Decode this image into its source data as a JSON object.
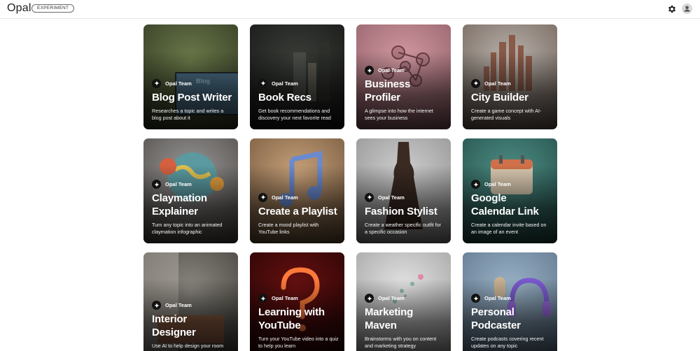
{
  "header": {
    "logo": "Opal",
    "badge": "EXPERIMENT"
  },
  "icons": {
    "settings": "gear-icon",
    "account": "account-icon",
    "author": "sparkle-icon"
  },
  "cards": [
    {
      "author": "Opal Team",
      "title": "Blog Post Writer",
      "description": "Researches a topic and writes a blog post about it",
      "art_text": "Blog",
      "colors": [
        "#6b7a4a",
        "#2e3320"
      ]
    },
    {
      "author": "Opal Team",
      "title": "Book Recs",
      "description": "Get book recommendations and discovery your next favorite read",
      "colors": [
        "#3a3d38",
        "#121412"
      ]
    },
    {
      "author": "Opal Team",
      "title": "Business Profiler",
      "description": "A glimpse into how the internet sees your business",
      "colors": [
        "#d49aa2",
        "#8a5a63"
      ]
    },
    {
      "author": "Opal Team",
      "title": "City Builder",
      "description": "Create a game concept with AI-generated visuals",
      "colors": [
        "#b9b4ae",
        "#6b5a50"
      ]
    },
    {
      "author": "Opal Team",
      "title": "Claymation Explainer",
      "description": "Turn any topic into an animated claymation infographic",
      "colors": [
        "#9a9a9a",
        "#4a4440"
      ]
    },
    {
      "author": "Opal Team",
      "title": "Create a Playlist",
      "description": "Create a mood playlist with YouTube links",
      "colors": [
        "#c9a27a",
        "#6a5038"
      ]
    },
    {
      "author": "Opal Team",
      "title": "Fashion Stylist",
      "description": "Create a weather specific outfit for a specific occasion",
      "colors": [
        "#cfcfcf",
        "#8c8c8c"
      ]
    },
    {
      "author": "Opal Team",
      "title": "Google Calendar Link",
      "description": "Create a calendar invite based on an image of an event",
      "colors": [
        "#4f8f86",
        "#1f4a45"
      ]
    },
    {
      "author": "Opal Team",
      "title": "Interior Designer",
      "description": "Use AI to help design your room",
      "colors": [
        "#8a8780",
        "#3f3b36"
      ]
    },
    {
      "author": "Opal Team",
      "title": "Learning with YouTube",
      "description": "Turn your YouTube video into a quiz to help you learn",
      "colors": [
        "#6a1010",
        "#200404"
      ]
    },
    {
      "author": "Opal Team",
      "title": "Marketing Maven",
      "description": "Brainstorms with you on content and marketing strategy",
      "colors": [
        "#e4e4e4",
        "#9a9a9a"
      ]
    },
    {
      "author": "Opal Team",
      "title": "Personal Podcaster",
      "description": "Create podcasts covering recent updates on any topic",
      "colors": [
        "#9ab3c7",
        "#5a6f86"
      ]
    }
  ]
}
